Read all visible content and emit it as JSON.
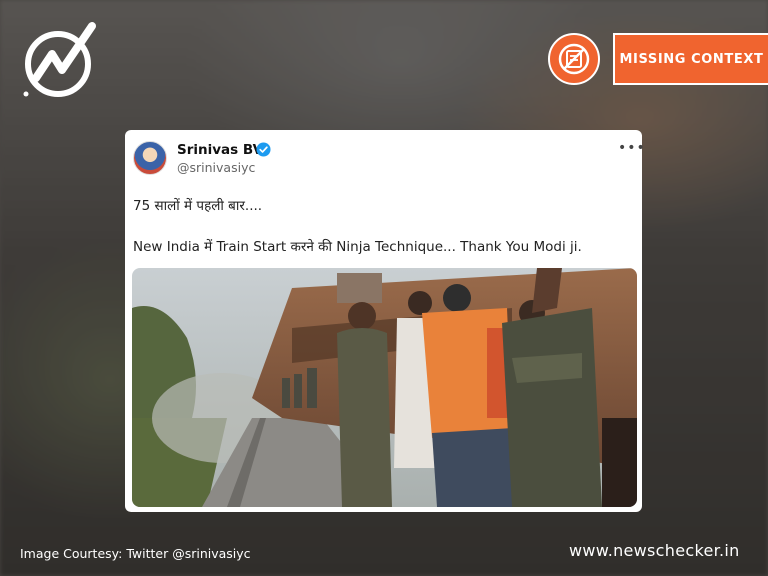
{
  "brand": {
    "logo_icon": "newschecker-logo-icon",
    "website": "www.newschecker.in"
  },
  "badge": {
    "icon": "missing-context-icon",
    "label": "MISSING CONTEXT",
    "color": "#f0642f"
  },
  "tweet": {
    "author_name": "Srinivas BV",
    "verified_icon": "verified-badge-icon",
    "handle": "@srinivasiyc",
    "more_icon": "more-options-icon",
    "text_line1": "75 सालों में पहली बार....",
    "text_line2": "New India में Train Start करने की Ninja Technique... Thank You Modi ji.",
    "media_description": "video-thumbnail"
  },
  "footer": {
    "courtesy": "Image Courtesy: Twitter @srinivasiyc"
  }
}
